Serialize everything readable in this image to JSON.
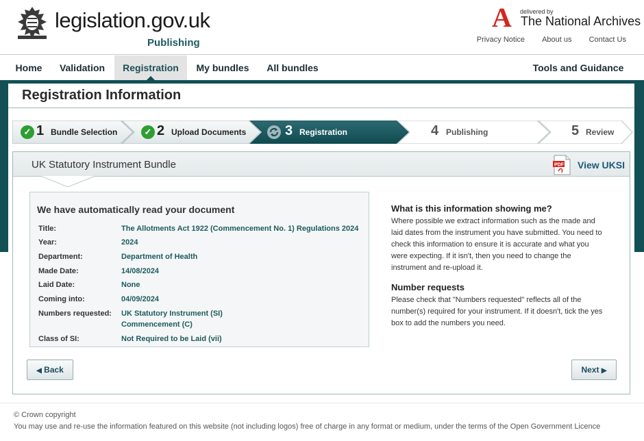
{
  "header": {
    "site_name": "legislation.gov.uk",
    "site_sub": "Publishing",
    "tna_delivered": "delivered by",
    "tna_name": "The National Archives",
    "links": [
      "Privacy Notice",
      "About us",
      "Contact Us"
    ]
  },
  "nav": {
    "items": [
      "Home",
      "Validation",
      "Registration",
      "My bundles",
      "All bundles"
    ],
    "right": "Tools and Guidance",
    "active": "Registration"
  },
  "page_title": "Registration Information",
  "steps": [
    {
      "num": "1",
      "label": "Bundle Selection",
      "state": "done"
    },
    {
      "num": "2",
      "label": "Upload Documents",
      "state": "done"
    },
    {
      "num": "3",
      "label": "Registration",
      "state": "current"
    },
    {
      "num": "4",
      "label": "Publishing",
      "state": "todo"
    },
    {
      "num": "5",
      "label": "Review",
      "state": "todo"
    }
  ],
  "panel": {
    "title": "UK Statutory Instrument Bundle",
    "view_link": "View UKSI"
  },
  "info": {
    "heading": "We have automatically read your document",
    "rows": [
      {
        "label": "Title:",
        "value": "The Allotments Act 1922 (Commencement No. 1) Regulations 2024"
      },
      {
        "label": "Year:",
        "value": "2024"
      },
      {
        "label": "Department:",
        "value": "Department of Health"
      },
      {
        "label": "Made Date:",
        "value": "14/08/2024"
      },
      {
        "label": "Laid Date:",
        "value": "None"
      },
      {
        "label": "Coming into:",
        "value": "04/09/2024"
      },
      {
        "label": "Numbers requested:",
        "value": "UK Statutory Instrument (SI)",
        "value2": "Commencement (C)"
      },
      {
        "label": "Class of SI:",
        "value": "Not Required to be Laid (vii)"
      }
    ]
  },
  "help": {
    "h1": "What is this information showing me?",
    "p1_lines": [
      "Where possible we extract information such as the made and",
      "laid dates from the instrument you have submitted. You need to",
      "check this information to ensure it is accurate and what you",
      "were expecting. If it isn't, then you need to change the",
      "instrument and re-upload it."
    ],
    "h2": "Number requests",
    "p2_lines": [
      "Please check that \"Numbers requested\" reflects all of the",
      "number(s) required for your instrument. If it doesn't, tick the yes",
      "box to add the numbers you need."
    ]
  },
  "buttons": {
    "back": "Back",
    "next": "Next"
  },
  "footer": {
    "copyright": "© Crown copyright",
    "licence_text": "You may use and re-use the information featured on this website (not including logos) free of charge in any format or medium, under the terms of the Open Government Licence"
  },
  "colors": {
    "teal": "#125055",
    "success": "#2e9e33",
    "link": "#1c5a79"
  }
}
